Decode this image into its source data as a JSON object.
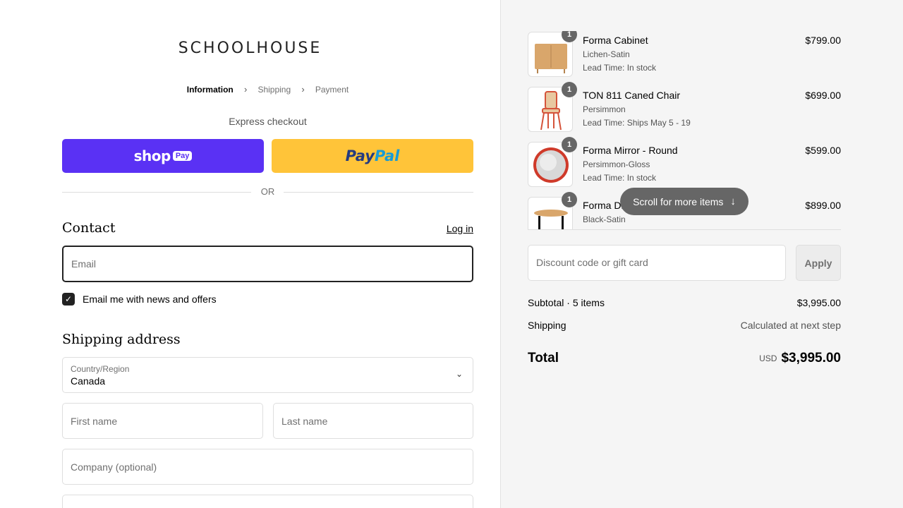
{
  "brand": {
    "logo": "SCHOOLHOUSE"
  },
  "breadcrumb": [
    "Information",
    "Shipping",
    "Payment"
  ],
  "express": {
    "label": "Express checkout",
    "shop_pay_word": "shop",
    "shop_pay_badge": "Pay",
    "paypal_a": "Pay",
    "paypal_b": "Pal",
    "or": "OR"
  },
  "contact": {
    "heading": "Contact",
    "login": "Log in",
    "email_placeholder": "Email",
    "news_label": "Email me with news and offers",
    "news_checked": true
  },
  "shipping": {
    "heading": "Shipping address",
    "country_label": "Country/Region",
    "country_value": "Canada",
    "first_name": "First name",
    "last_name": "Last name",
    "company": "Company (optional)"
  },
  "cart": {
    "items": [
      {
        "qty": "1",
        "name": "Forma Cabinet",
        "variant": "Lichen-Satin",
        "lead": "Lead Time: In stock",
        "price": "$799.00"
      },
      {
        "qty": "1",
        "name": "TON 811 Caned Chair",
        "variant": "Persimmon",
        "lead": "Lead Time: Ships May 5 - 19",
        "price": "$699.00"
      },
      {
        "qty": "1",
        "name": "Forma Mirror - Round",
        "variant": "Persimmon-Gloss",
        "lead": "Lead Time: In stock",
        "price": "$599.00"
      },
      {
        "qty": "1",
        "name": "Forma Di",
        "variant": "Black-Satin",
        "lead": "",
        "price": "$899.00"
      }
    ],
    "scroll_hint": "Scroll for more items",
    "discount_placeholder": "Discount code or gift card",
    "apply": "Apply",
    "subtotal_label": "Subtotal · 5 items",
    "subtotal_value": "$3,995.00",
    "shipping_label": "Shipping",
    "shipping_value": "Calculated at next step",
    "total_label": "Total",
    "currency": "USD",
    "total_value": "$3,995.00"
  },
  "colors": {
    "shop_pay": "#5a31f4",
    "paypal": "#ffc439",
    "summary_bg": "#f5f5f5"
  }
}
